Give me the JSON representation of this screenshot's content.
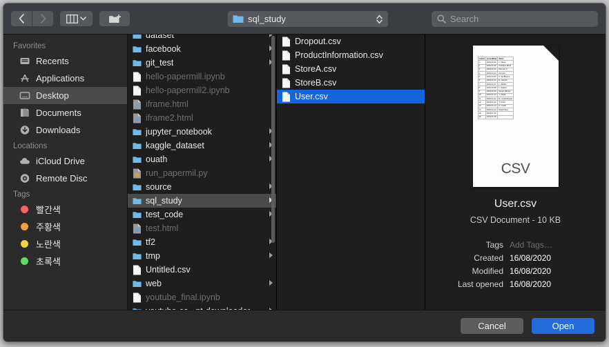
{
  "toolbar": {
    "back_icon": "chevron-left-icon",
    "forward_icon": "chevron-right-icon",
    "view_icon": "column-view-icon",
    "view_chevron": "chevron-down-icon",
    "new_folder_icon": "new-folder-icon",
    "path_label": "sql_study",
    "path_icon": "folder-icon",
    "stepper_icon": "up-down-stepper-icon",
    "search_icon": "search-icon",
    "search_placeholder": "Search",
    "search_value": ""
  },
  "sidebar": {
    "sections": [
      {
        "header": "Favorites",
        "items": [
          {
            "label": "Recents",
            "icon": "recents-icon",
            "selected": false
          },
          {
            "label": "Applications",
            "icon": "applications-icon",
            "selected": false
          },
          {
            "label": "Desktop",
            "icon": "desktop-icon",
            "selected": true
          },
          {
            "label": "Documents",
            "icon": "documents-icon",
            "selected": false
          },
          {
            "label": "Downloads",
            "icon": "downloads-icon",
            "selected": false
          }
        ]
      },
      {
        "header": "Locations",
        "items": [
          {
            "label": "iCloud Drive",
            "icon": "cloud-icon",
            "selected": false
          },
          {
            "label": "Remote Disc",
            "icon": "optical-disc-icon",
            "selected": false
          }
        ]
      },
      {
        "header": "Tags",
        "items": [
          {
            "label": "빨간색",
            "icon": "tag-dot-icon",
            "color": "#f4655f",
            "selected": false
          },
          {
            "label": "주황색",
            "icon": "tag-dot-icon",
            "color": "#efa13c",
            "selected": false
          },
          {
            "label": "노란색",
            "icon": "tag-dot-icon",
            "color": "#f3d13f",
            "selected": false
          },
          {
            "label": "초록색",
            "icon": "tag-dot-icon",
            "color": "#63d862",
            "selected": false
          }
        ]
      }
    ]
  },
  "columns": [
    {
      "name": "column-one",
      "has_scrollbar": true,
      "rows": [
        {
          "label": "dataset",
          "type": "folder",
          "state": "clipped",
          "arrow": true
        },
        {
          "label": "facebook",
          "type": "folder",
          "state": "normal",
          "arrow": true
        },
        {
          "label": "git_test",
          "type": "folder",
          "state": "normal",
          "arrow": true
        },
        {
          "label": "hello-papermill.ipynb",
          "type": "file",
          "state": "disabled",
          "arrow": false
        },
        {
          "label": "hello-papermill2.ipynb",
          "type": "file",
          "state": "disabled",
          "arrow": false
        },
        {
          "label": "iframe.html",
          "type": "html",
          "state": "disabled",
          "arrow": false
        },
        {
          "label": "iframe2.html",
          "type": "html",
          "state": "disabled",
          "arrow": false
        },
        {
          "label": "jupyter_notebook",
          "type": "folder",
          "state": "normal",
          "arrow": true
        },
        {
          "label": "kaggle_dataset",
          "type": "folder",
          "state": "normal",
          "arrow": true
        },
        {
          "label": "ouath",
          "type": "folder",
          "state": "normal",
          "arrow": true
        },
        {
          "label": "run_papermil.py",
          "type": "python",
          "state": "disabled",
          "arrow": false
        },
        {
          "label": "source",
          "type": "folder",
          "state": "normal",
          "arrow": true
        },
        {
          "label": "sql_study",
          "type": "folder",
          "state": "selected",
          "arrow": true
        },
        {
          "label": "test_code",
          "type": "folder",
          "state": "normal",
          "arrow": true
        },
        {
          "label": "test.html",
          "type": "html",
          "state": "disabled",
          "arrow": false
        },
        {
          "label": "tf2",
          "type": "folder",
          "state": "normal",
          "arrow": true
        },
        {
          "label": "tmp",
          "type": "folder",
          "state": "normal",
          "arrow": true
        },
        {
          "label": "Untitled.csv",
          "type": "file",
          "state": "normal",
          "arrow": false
        },
        {
          "label": "web",
          "type": "folder",
          "state": "normal",
          "arrow": true
        },
        {
          "label": "youtube_final.ipynb",
          "type": "file",
          "state": "disabled",
          "arrow": false
        },
        {
          "label": "youtube-co...nt-downloader",
          "type": "folder",
          "state": "normal",
          "arrow": true
        }
      ]
    },
    {
      "name": "column-two",
      "has_scrollbar": false,
      "rows": [
        {
          "label": "Dropout.csv",
          "type": "file",
          "state": "normal",
          "arrow": false
        },
        {
          "label": "ProductInformation.csv",
          "type": "file",
          "state": "normal",
          "arrow": false
        },
        {
          "label": "StoreA.csv",
          "type": "file",
          "state": "normal",
          "arrow": false
        },
        {
          "label": "StoreB.csv",
          "type": "file",
          "state": "normal",
          "arrow": false
        },
        {
          "label": "User.csv",
          "type": "file",
          "state": "highlighted",
          "arrow": false
        }
      ]
    }
  ],
  "preview": {
    "thumbnail_icon": "csv-document-thumbnail",
    "watermark": "CSV",
    "name": "User.csv",
    "kind": "CSV Document - 10 KB",
    "meta": [
      {
        "key": "Tags",
        "value": "Add Tags…",
        "placeholder": true
      },
      {
        "key": "Created",
        "value": "16/08/2020",
        "placeholder": false
      },
      {
        "key": "Modified",
        "value": "16/08/2020",
        "placeholder": false
      },
      {
        "key": "Last opened",
        "value": "16/08/2020",
        "placeholder": false
      }
    ],
    "csv_table": {
      "headers": [
        "UserId",
        "JoinedDate",
        "Name"
      ],
      "rows": [
        [
          "1",
          "2019-01-01",
          "L. Messi"
        ],
        [
          "2",
          "2019-01-02",
          "Cristiano Rona"
        ],
        [
          "3",
          "2019-01-03",
          "Neymar Jr"
        ],
        [
          "4",
          "2019-01-04",
          "De Gea"
        ],
        [
          "5",
          "2019-01-05",
          "K. De Bruyne"
        ],
        [
          "6",
          "2019-01-06",
          "E. Hazard"
        ],
        [
          "7",
          "2019-01-07",
          "L. Modrić"
        ],
        [
          "8",
          "2019-01-08",
          "L. Suárez"
        ],
        [
          "9",
          "2019-01-09",
          "Sergio Ramos"
        ],
        [
          "10",
          "2019-01-10",
          "J. Oblak"
        ],
        [
          "11",
          "2019-01-11",
          "R. Lewandowski"
        ],
        [
          "12",
          "2019-01-12",
          "T. Kroos"
        ],
        [
          "13",
          "2019-01-13",
          "D. Godín"
        ],
        [
          "14",
          "2019-01-14",
          "David Silva"
        ],
        [
          "15",
          "2019-01-15",
          ""
        ],
        [
          "16",
          "2019-01-16",
          ""
        ]
      ]
    }
  },
  "footer": {
    "cancel_label": "Cancel",
    "open_label": "Open"
  },
  "colors": {
    "accent_blue": "#1464dc",
    "open_button": "#246bdd",
    "folder_blue": "#6fb8e8",
    "toolbar_bg": "#3a3e42",
    "sidebar_bg": "#2b2b2b",
    "column_bg": "#1e1e1e"
  }
}
